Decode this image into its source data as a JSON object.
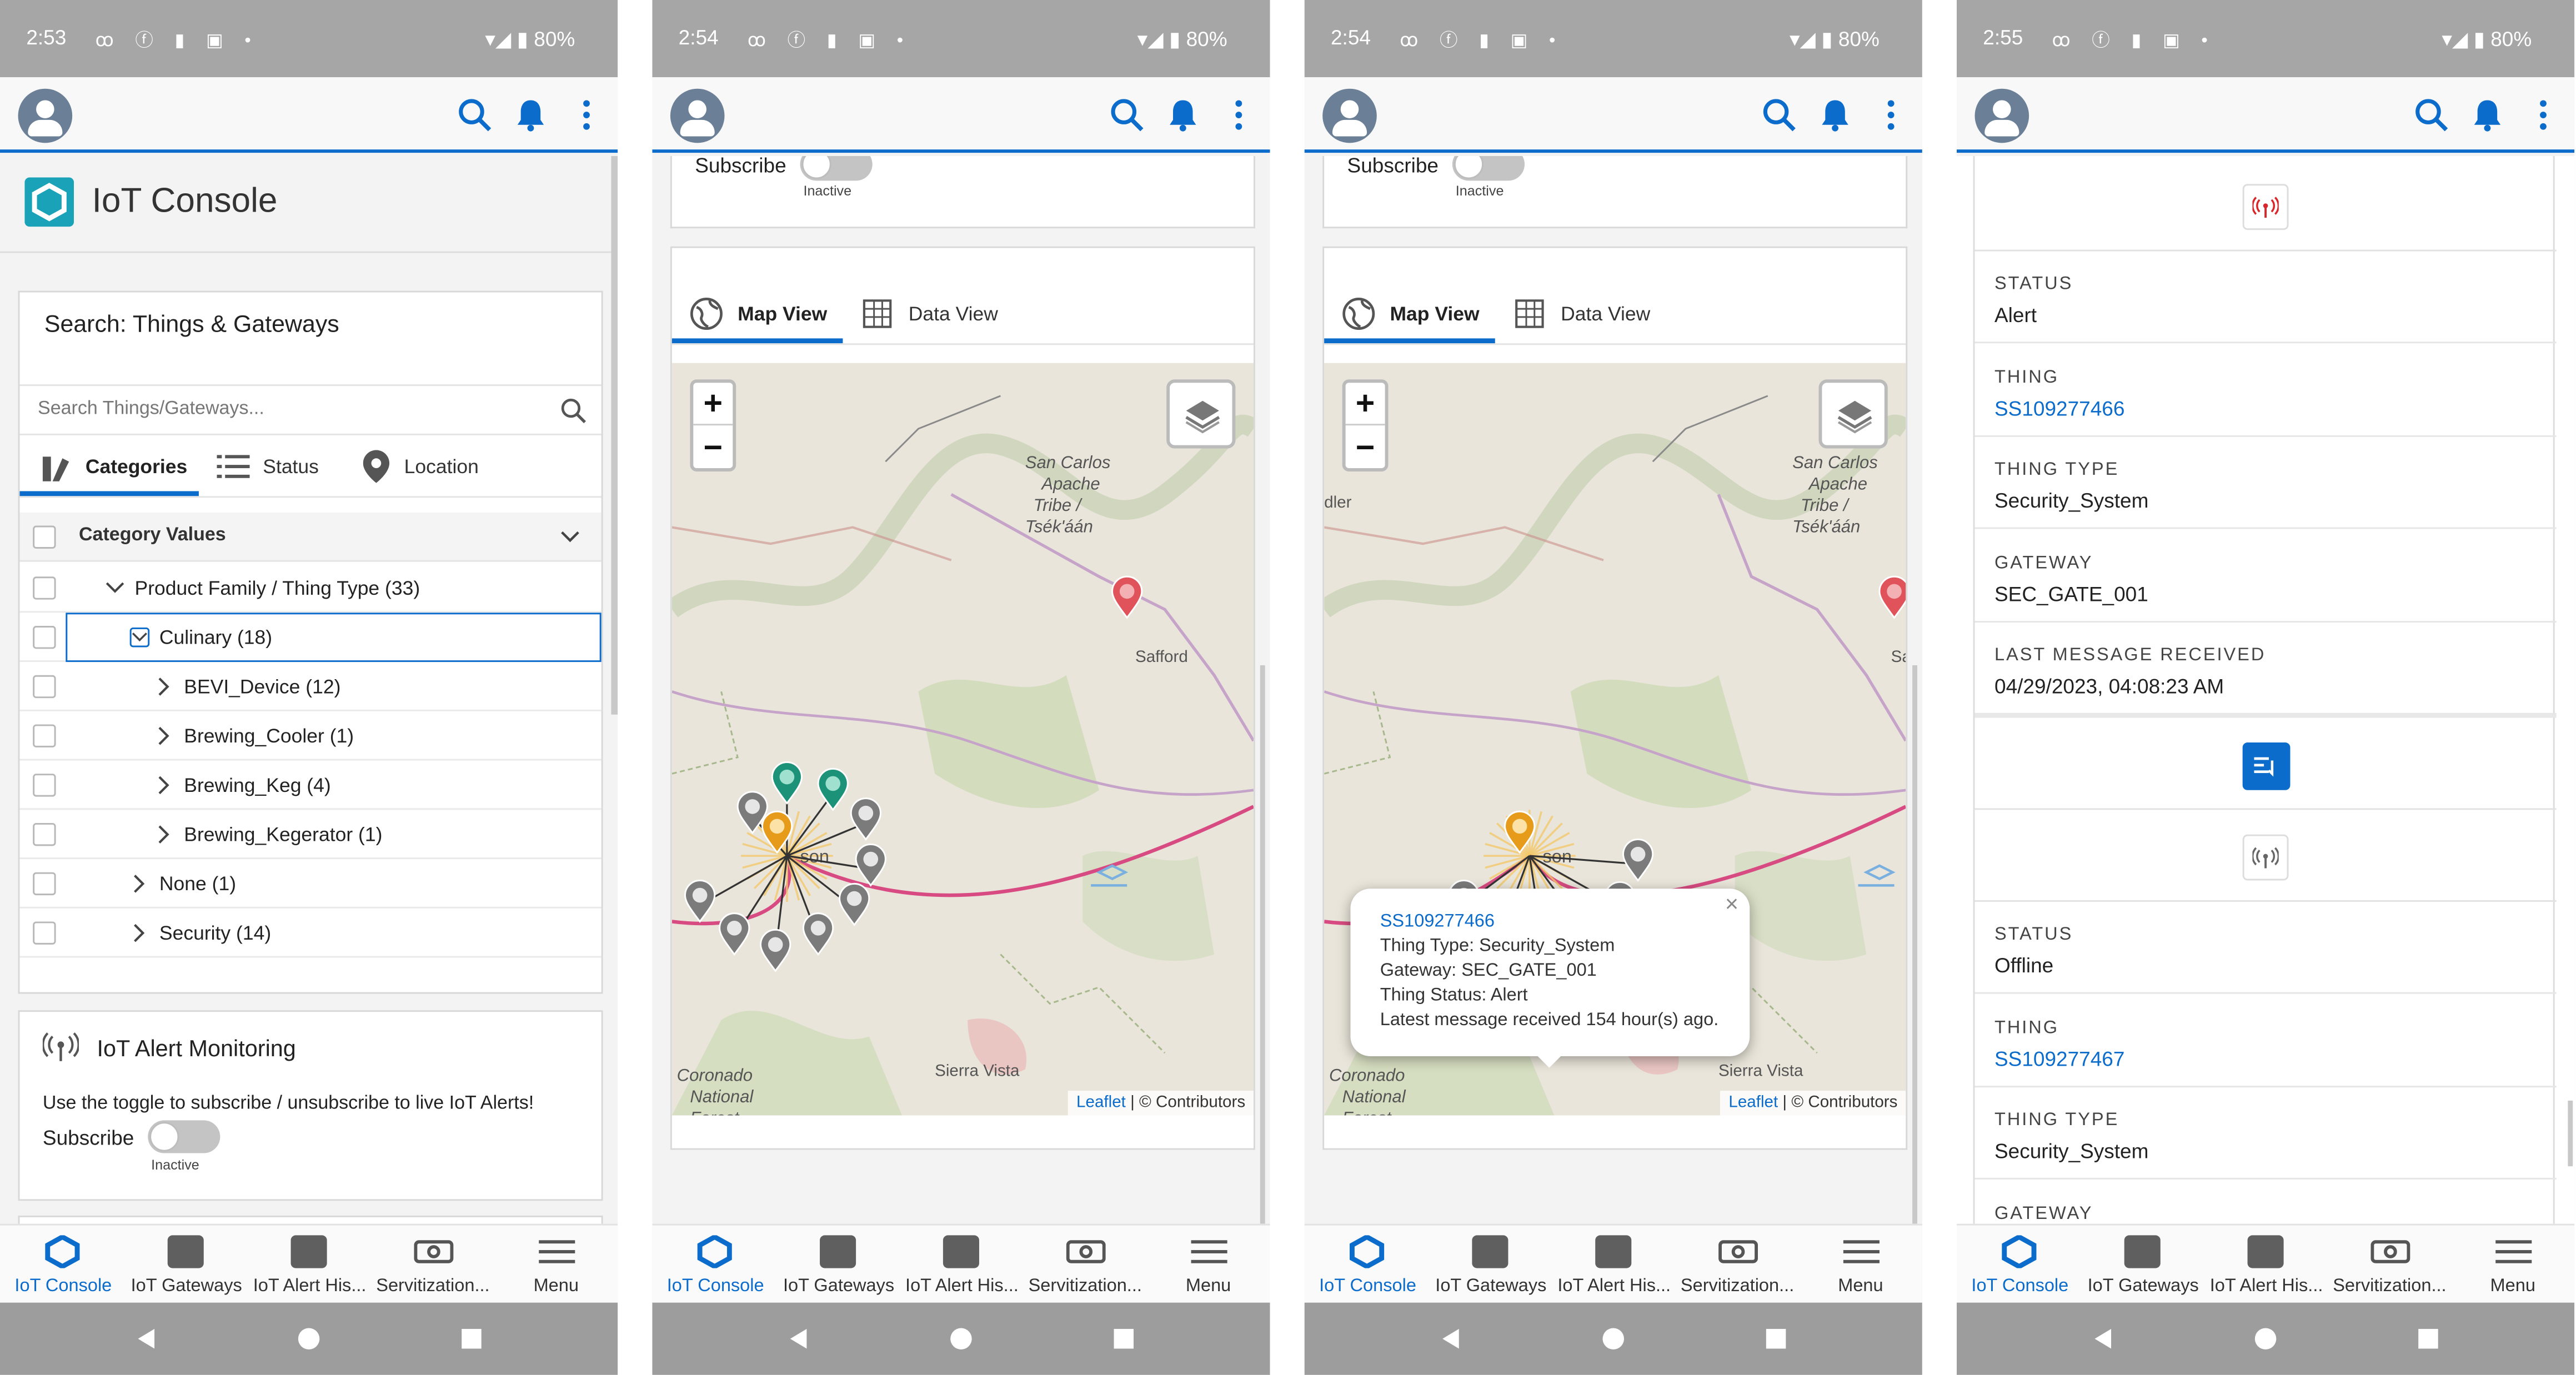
{
  "common": {
    "status_icons": "ꝏ ⓕ ▮ ▣ •",
    "battery": "80%",
    "nav": [
      "IoT Console",
      "IoT Gateways",
      "IoT Alert His...",
      "Servitization...",
      "Menu"
    ],
    "accent": "#0b6ccb"
  },
  "screens": [
    {
      "time": "2:53"
    },
    {
      "time": "2:54"
    },
    {
      "time": "2:54"
    },
    {
      "time": "2:55"
    }
  ],
  "s1": {
    "title": "IoT Console",
    "search_title": "Search: Things & Gateways",
    "search_placeholder": "Search Things/Gateways...",
    "tabs": [
      "Categories",
      "Status",
      "Location"
    ],
    "category_header": "Category Values",
    "tree": [
      {
        "label": "Product Family / Thing Type (33)",
        "indent": 0,
        "state": "open"
      },
      {
        "label": "Culinary (18)",
        "indent": 1,
        "state": "open",
        "selected": true
      },
      {
        "label": "BEVI_Device (12)",
        "indent": 2,
        "state": "closed"
      },
      {
        "label": "Brewing_Cooler (1)",
        "indent": 2,
        "state": "closed"
      },
      {
        "label": "Brewing_Keg (4)",
        "indent": 2,
        "state": "closed"
      },
      {
        "label": "Brewing_Kegerator (1)",
        "indent": 2,
        "state": "closed"
      },
      {
        "label": "None (1)",
        "indent": 1,
        "state": "closed"
      },
      {
        "label": "Security (14)",
        "indent": 1,
        "state": "closed"
      }
    ],
    "alert_title": "IoT Alert Monitoring",
    "alert_text": "Use the toggle to subscribe / unsubscribe to live IoT Alerts!",
    "subscribe": "Subscribe",
    "inactive": "Inactive"
  },
  "map": {
    "subscribe": "Subscribe",
    "inactive": "Inactive",
    "tab_map": "Map View",
    "tab_data": "Data View",
    "zoom_in": "+",
    "zoom_out": "−",
    "attrib_link": "Leaflet",
    "attrib_rest": " | © Contributors",
    "labels": {
      "san_carlos": [
        "San Carlos",
        "Apache",
        "Tribe /",
        "Tsék'áán"
      ],
      "safford": "Safford",
      "sierra_vista": "Sierra Vista",
      "coronado": [
        "Coronado",
        "National",
        "Forest"
      ],
      "tucson": "son",
      "edge_dler": "dler",
      "edge_saff": "Saffo"
    }
  },
  "popup": {
    "link": "SS109277466",
    "lines": [
      "Thing Type: Security_System",
      "Gateway: SEC_GATE_001",
      "Thing Status: Alert",
      "Latest message received 154 hour(s) ago."
    ],
    "close": "×"
  },
  "s4": {
    "alert_record": [
      {
        "label": "STATUS",
        "value": "Alert"
      },
      {
        "label": "THING",
        "value": "SS109277466",
        "link": true
      },
      {
        "label": "THING TYPE",
        "value": "Security_System"
      },
      {
        "label": "GATEWAY",
        "value": "SEC_GATE_001"
      },
      {
        "label": "LAST MESSAGE RECEIVED",
        "value": "04/29/2023, 04:08:23 AM"
      }
    ],
    "offline_record": [
      {
        "label": "STATUS",
        "value": "Offline"
      },
      {
        "label": "THING",
        "value": "SS109277467",
        "link": true
      },
      {
        "label": "THING TYPE",
        "value": "Security_System"
      },
      {
        "label": "GATEWAY",
        "value": ""
      }
    ]
  }
}
